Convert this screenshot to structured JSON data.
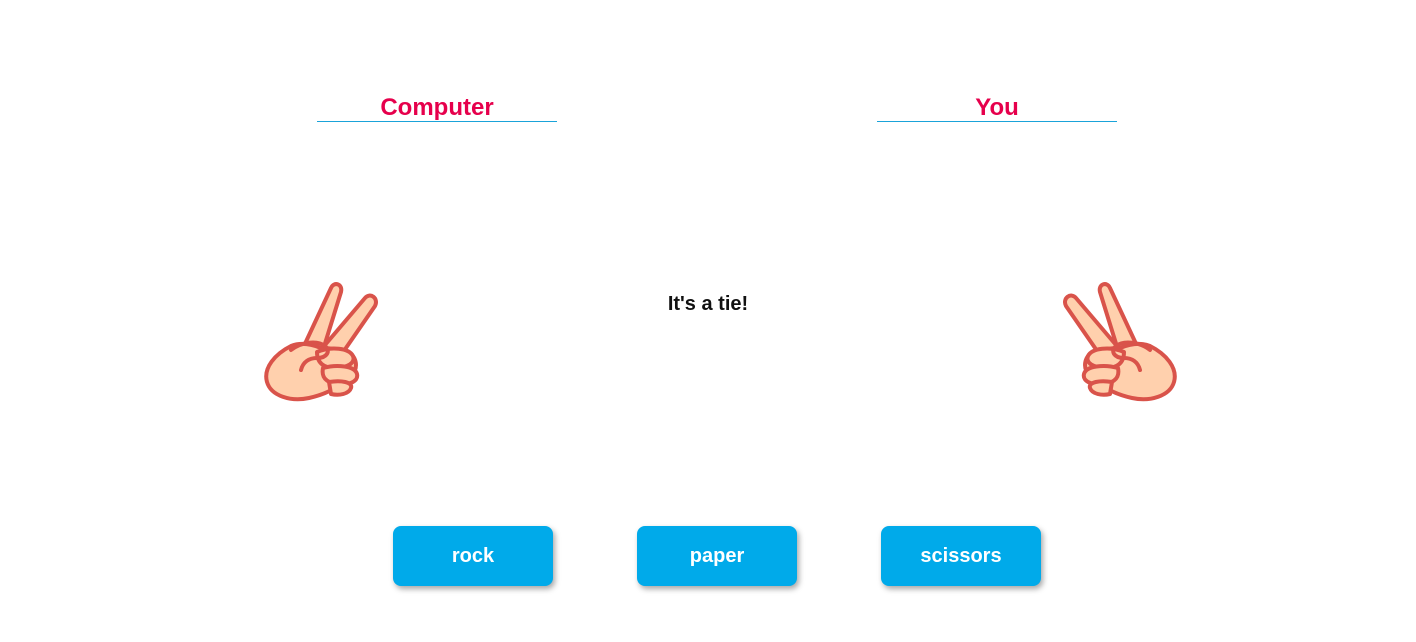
{
  "players": {
    "computer_label": "Computer",
    "you_label": "You"
  },
  "hands": {
    "computer_choice_icon": "victory-hand-icon",
    "you_choice_icon": "victory-hand-icon"
  },
  "result": {
    "message": "It's a tie!"
  },
  "buttons": {
    "rock": "rock",
    "paper": "paper",
    "scissors": "scissors"
  },
  "colors": {
    "label": "#e6004c",
    "underline": "#1aa3d9",
    "button_bg": "#00aaea",
    "button_text": "#ffffff",
    "hand_fill": "#ffd0ad",
    "hand_stroke": "#d9534a"
  }
}
